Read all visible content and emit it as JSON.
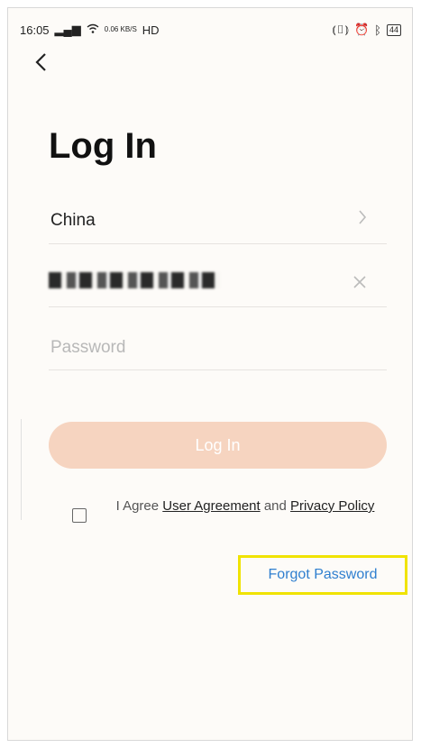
{
  "status_bar": {
    "time": "16:05",
    "signal": "4G",
    "wifi": "≋",
    "net_speed": "0.06 KB/S",
    "hd": "HD",
    "battery": "44"
  },
  "screen": {
    "title": "Log In",
    "country": "China",
    "password_placeholder": "Password",
    "login_button": "Log In",
    "agreement": {
      "prefix": "I Agree ",
      "user_agreement": "User Agreement",
      "middle": " and ",
      "privacy_policy": "Privacy Policy"
    },
    "forgot_password": "Forgot Password"
  }
}
